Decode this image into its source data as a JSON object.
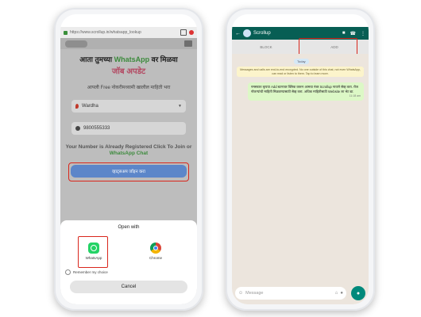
{
  "left_phone": {
    "url": "https://www.scrollup.in/whatsapp_lookup",
    "hero_line1_prefix": "आता तुमच्या",
    "hero_line1_brand": "WhatsApp",
    "hero_line1_suffix": "वर मिळवा",
    "hero_line2": "जॉब अपडेट",
    "hero_note": "आपली Free नोकरीमध्यामी खालील माहिती भरा",
    "city_value": "Wardha",
    "phone_value": "9800555333",
    "registered_text": "Your Number is Already Registered Click To Join or",
    "registered_link": "WhatsApp Chat",
    "join_button_label": "व्हाट्सअप जॉइन करा",
    "sheet": {
      "title": "Open with",
      "options": [
        {
          "name": "WhatsApp",
          "icon": "whatsapp-icon"
        },
        {
          "name": "Chrome",
          "icon": "chrome-icon"
        }
      ],
      "remember_label": "Remember my choice",
      "cancel_label": "Cancel"
    }
  },
  "right_phone": {
    "chat_title": "Scrollup",
    "tabs": [
      "BLOCK",
      "ADD"
    ],
    "date_label": "Today",
    "encryption_notice": "Messages and calls are end-to-end encrypted. No one outside of this chat, not even WhatsApp, can read or listen to them. Tap to learn more.",
    "message_text": "नमस्कार! कृपया Add बटनावर क्लिक करून आमचा नंबर Scrollup नावाने सेव्ह करा. रोज नोकऱ्यांची माहिती मिळवण्यासाठी सेव्ह करा. अधिक माहितीसाठी Website ला भेट द्या.",
    "message_time": "11:18 am",
    "input_placeholder": "Message"
  },
  "colors": {
    "whatsapp_header": "#075e54",
    "highlight_red": "#d9261c",
    "join_button": "#5c86c9",
    "message_bubble": "#dcf8c6",
    "mic_button": "#00897b"
  }
}
